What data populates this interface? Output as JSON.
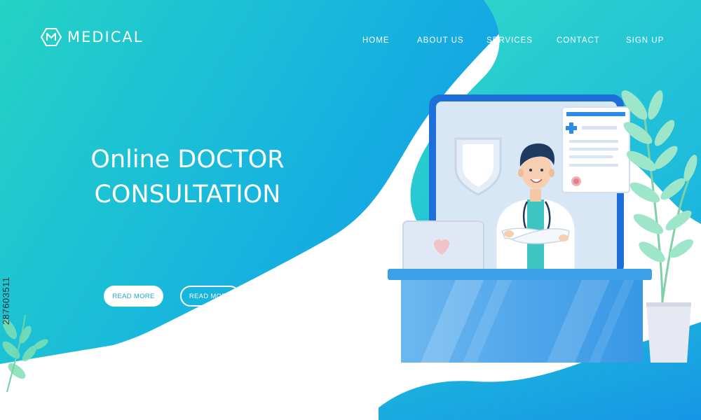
{
  "brand": {
    "name": "MEDICAL",
    "icon": "hexagon-m-icon"
  },
  "nav": {
    "items": [
      {
        "label": "HOME"
      },
      {
        "label": "ABOUT US"
      },
      {
        "label": "SERVICES"
      },
      {
        "label": "CONTACT"
      },
      {
        "label": "SIGN UP"
      }
    ]
  },
  "hero": {
    "title_line1": "Online DOCTOR",
    "title_line2": "CONSULTATION",
    "button_primary": "READ MORE",
    "button_secondary": "READ MORE"
  },
  "side_id": "287603511",
  "colors": {
    "teal": "#1fd1c4",
    "blue": "#16a3e6",
    "white": "#ffffff",
    "desk_blue": "#3aa3e8",
    "screen_bg": "#d6e6f5",
    "coat": "#ffffff",
    "scrubs": "#3cc4c0"
  }
}
